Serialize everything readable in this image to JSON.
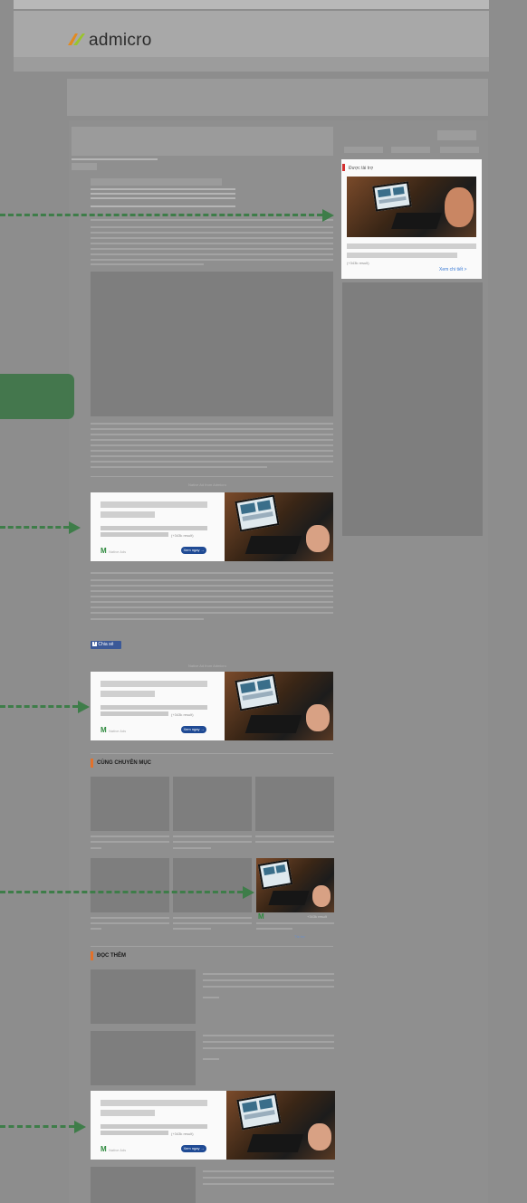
{
  "header": {
    "logo_text": "admicro"
  },
  "sidebar_ad": {
    "label": "Được tài trợ",
    "result": "(+343k result)",
    "link": "Xem chi tiết >"
  },
  "native_ads": [
    {
      "caption": "Native Ad from Admicro",
      "brand": "Native Ads",
      "result": "(+343k result)",
      "button": "Xem ngay →"
    },
    {
      "caption": "Native Ad from Admicro",
      "brand": "Native Ads",
      "result": "(+343k result)",
      "button": "Xem ngay →"
    },
    {
      "brand": "Native Ads",
      "result": "(+343k result)",
      "button": "Xem ngay →"
    }
  ],
  "share_button": "Chia sẻ",
  "sections": {
    "related": "CÙNG CHUYÊN MỤC",
    "read_more": "ĐỌC THÊM"
  },
  "grid_ad": {
    "result": "+343k result",
    "link": "Tài trợ"
  },
  "colors": {
    "accent_arrow": "#3e7d49",
    "cta_button": "#1f4a94",
    "section_bar": "#e2712b",
    "ad_brand": "#2e8a3e"
  }
}
